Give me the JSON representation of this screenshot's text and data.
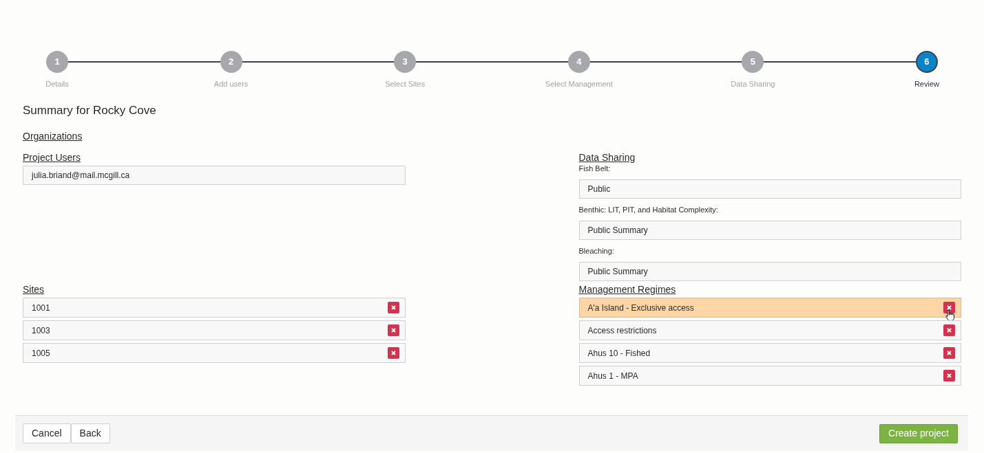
{
  "steps": [
    {
      "number": "1",
      "label": "Details",
      "selected": false
    },
    {
      "number": "2",
      "label": "Add users",
      "selected": false
    },
    {
      "number": "3",
      "label": "Select Sites",
      "selected": false
    },
    {
      "number": "4",
      "label": "Select Management",
      "selected": false
    },
    {
      "number": "5",
      "label": "Data Sharing",
      "selected": false
    },
    {
      "number": "6",
      "label": "Review",
      "selected": true
    }
  ],
  "title": "Summary for Rocky Cove",
  "organizations": {
    "heading": "Organizations"
  },
  "project_users": {
    "heading": "Project Users",
    "items": [
      "julia.briand@mail.mcgill.ca"
    ]
  },
  "data_sharing": {
    "heading": "Data Sharing",
    "fields": [
      {
        "label": "Fish Belt:",
        "value": "Public"
      },
      {
        "label": "Benthic: LIT, PIT, and Habitat Complexity:",
        "value": "Public Summary"
      },
      {
        "label": "Bleaching:",
        "value": "Public Summary"
      }
    ]
  },
  "sites": {
    "heading": "Sites",
    "items": [
      {
        "name": "1001",
        "hovered": false
      },
      {
        "name": "1003",
        "hovered": false
      },
      {
        "name": "1005",
        "hovered": false
      }
    ]
  },
  "management_regimes": {
    "heading": "Management Regimes",
    "items": [
      {
        "name": "A'a Island - Exclusive access",
        "hovered": true
      },
      {
        "name": "Access restrictions",
        "hovered": false
      },
      {
        "name": "Ahus 10 - Fished",
        "hovered": false
      },
      {
        "name": "Ahus 1 - MPA",
        "hovered": false
      }
    ]
  },
  "footer": {
    "buttons": [
      "Cancel",
      "Back"
    ],
    "primary": "Create project"
  }
}
